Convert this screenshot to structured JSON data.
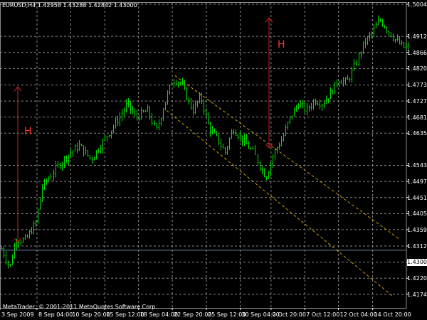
{
  "window": {
    "symbol_info": "EURUSD,H4  1.42958 1.43288 1.42842 1.43000",
    "copyright": "MetaTrader, © 2001-2011 MetaQuotes Software Corp."
  },
  "annotations": {
    "left_height_label": "H",
    "right_height_label": "H"
  },
  "colors": {
    "background": "#000000",
    "grid": "#8a8a8a",
    "candles": "#00e000",
    "height_arrows": "#cc2222",
    "channel": "#c8a000",
    "current_price_line": "#6e7f9a"
  },
  "chart_data": {
    "type": "candlestick",
    "symbol": "EURUSD",
    "timeframe": "H4",
    "last_bar": {
      "open": 1.42958,
      "high": 1.43288,
      "low": 1.42842,
      "close": 1.43
    },
    "current_price": "1.43000",
    "ylim": [
      1.4135,
      1.501
    ],
    "y_ticks": [
      "1.50040",
      "1.49120",
      "1.48660",
      "1.48200",
      "1.47730",
      "1.47270",
      "1.46810",
      "1.46350",
      "1.45430",
      "1.44970",
      "1.44510",
      "1.44050",
      "1.43590",
      "1.43120",
      "1.42660",
      "1.42200",
      "1.41740"
    ],
    "x_ticks": [
      "3 Sep 2009",
      "8 Sep 04:00",
      "10 Sep 20:00",
      "15 Sep 12:00",
      "18 Sep 04:00",
      "22 Sep 20:00",
      "25 Sep 12:00",
      "30 Sep 04:00",
      "2 Oct 20:00",
      "7 Oct 12:00",
      "12 Oct 04:00",
      "14 Oct 20:00"
    ],
    "x_tick_pos": [
      0,
      0.091,
      0.174,
      0.258,
      0.341,
      0.424,
      0.508,
      0.591,
      0.667,
      0.75,
      0.833,
      0.917
    ],
    "price_path": [
      [
        0.0,
        1.4305
      ],
      [
        0.02,
        1.425
      ],
      [
        0.035,
        1.433
      ],
      [
        0.06,
        1.433
      ],
      [
        0.085,
        1.438
      ],
      [
        0.1,
        1.448
      ],
      [
        0.13,
        1.453
      ],
      [
        0.16,
        1.457
      ],
      [
        0.19,
        1.46
      ],
      [
        0.22,
        1.456
      ],
      [
        0.26,
        1.463
      ],
      [
        0.29,
        1.468
      ],
      [
        0.31,
        1.472
      ],
      [
        0.33,
        1.468
      ],
      [
        0.36,
        1.47
      ],
      [
        0.38,
        1.464
      ],
      [
        0.4,
        1.472
      ],
      [
        0.42,
        1.479
      ],
      [
        0.44,
        1.478
      ],
      [
        0.47,
        1.47
      ],
      [
        0.49,
        1.474
      ],
      [
        0.51,
        1.465
      ],
      [
        0.53,
        1.462
      ],
      [
        0.55,
        1.458
      ],
      [
        0.57,
        1.465
      ],
      [
        0.59,
        1.462
      ],
      [
        0.62,
        1.458
      ],
      [
        0.64,
        1.453
      ],
      [
        0.65,
        1.451
      ],
      [
        0.67,
        1.458
      ],
      [
        0.69,
        1.462
      ],
      [
        0.71,
        1.468
      ],
      [
        0.73,
        1.472
      ],
      [
        0.75,
        1.47
      ],
      [
        0.77,
        1.473
      ],
      [
        0.79,
        1.472
      ],
      [
        0.81,
        1.475
      ],
      [
        0.83,
        1.479
      ],
      [
        0.85,
        1.478
      ],
      [
        0.87,
        1.483
      ],
      [
        0.89,
        1.489
      ],
      [
        0.91,
        1.492
      ],
      [
        0.93,
        1.496
      ],
      [
        0.95,
        1.493
      ],
      [
        0.97,
        1.49
      ],
      [
        0.99,
        1.488
      ]
    ]
  }
}
